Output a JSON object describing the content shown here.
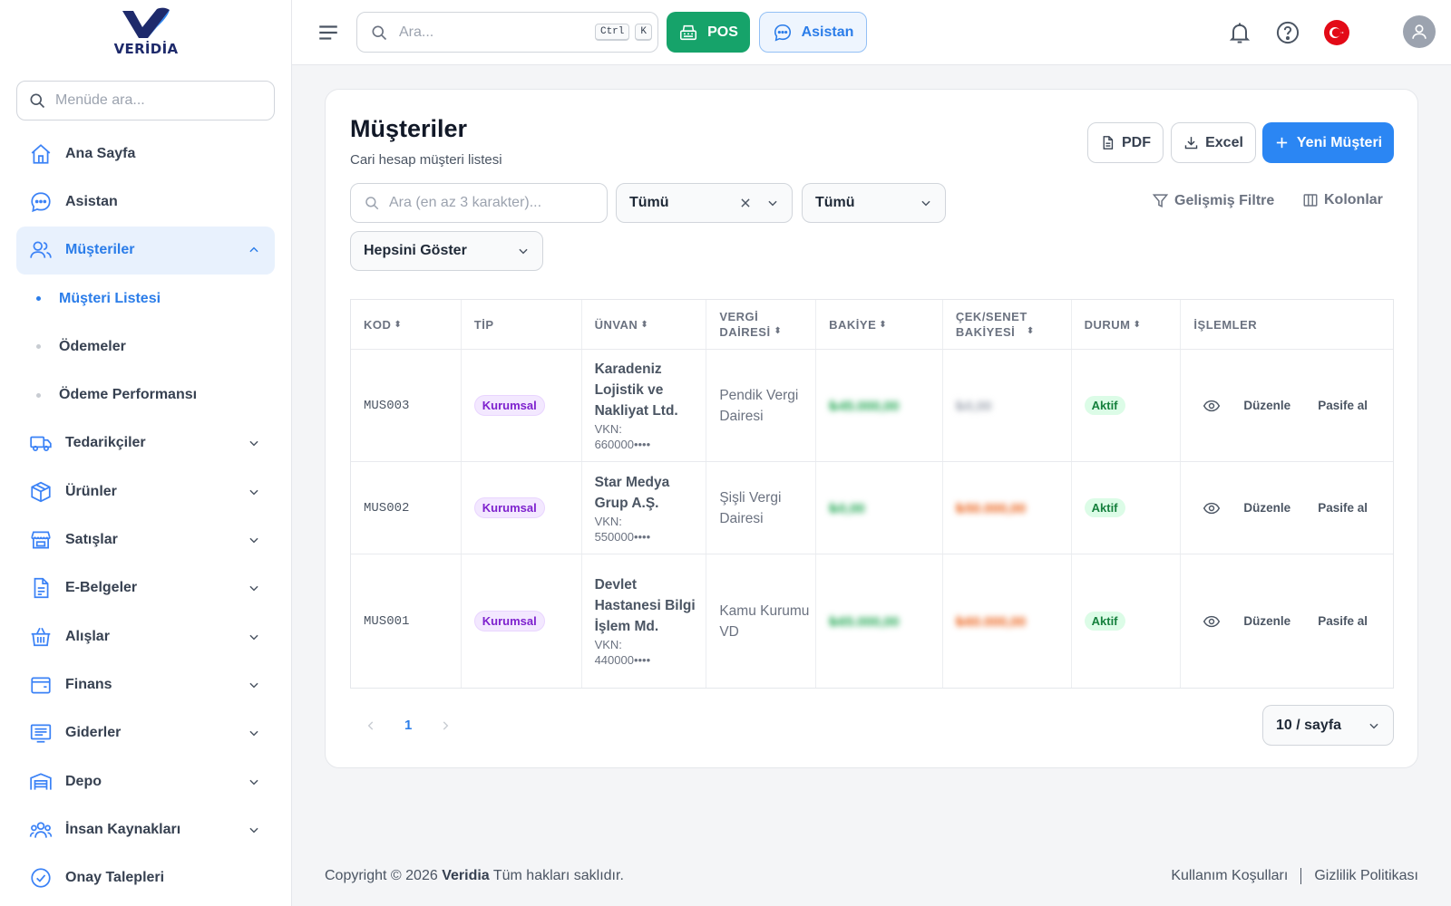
{
  "brand": {
    "name": "VERİDİA"
  },
  "sidebar": {
    "search_placeholder": "Menüde ara...",
    "items": [
      {
        "label": "Ana Sayfa",
        "icon": "home-icon"
      },
      {
        "label": "Asistan",
        "icon": "chat-icon"
      },
      {
        "label": "Müşteriler",
        "icon": "users-icon",
        "expanded": true,
        "children": [
          "Müşteri Listesi",
          "Ödemeler",
          "Ödeme Performansı"
        ]
      },
      {
        "label": "Tedarikçiler",
        "icon": "truck-icon"
      },
      {
        "label": "Ürünler",
        "icon": "box-icon"
      },
      {
        "label": "Satışlar",
        "icon": "store-icon"
      },
      {
        "label": "E-Belgeler",
        "icon": "document-icon"
      },
      {
        "label": "Alışlar",
        "icon": "basket-icon"
      },
      {
        "label": "Finans",
        "icon": "wallet-icon"
      },
      {
        "label": "Giderler",
        "icon": "receipt-icon"
      },
      {
        "label": "Depo",
        "icon": "warehouse-icon"
      },
      {
        "label": "İnsan Kaynakları",
        "icon": "people-icon"
      },
      {
        "label": "Onay Talepleri",
        "icon": "check-circle-icon"
      }
    ]
  },
  "topbar": {
    "search_placeholder": "Ara...",
    "shortcut_keys": [
      "Ctrl",
      "K"
    ],
    "pos_label": "POS",
    "assistant_label": "Asistan"
  },
  "page": {
    "title": "Müşteriler",
    "subtitle": "Cari hesap müşteri listesi",
    "pdf_label": "PDF",
    "excel_label": "Excel",
    "new_label": "Yeni Müşteri"
  },
  "filters": {
    "search_placeholder": "Ara (en az 3 karakter)...",
    "type_select": "Tümü",
    "status_select": "Tümü",
    "show_select": "Hepsini Göster",
    "advanced_label": "Gelişmiş Filtre",
    "columns_label": "Kolonlar"
  },
  "table": {
    "headers": [
      "KOD",
      "TİP",
      "ÜNVAN",
      "VERGİ DAİRESİ",
      "BAKİYE",
      "ÇEK/SENET BAKİYESİ",
      "DURUM",
      "İŞLEMLER"
    ],
    "rows": [
      {
        "code": "MUS003",
        "type": "Kurumsal",
        "name": "Karadeniz Lojistik ve Nakliyat Ltd.",
        "vkn_label": "VKN:",
        "vkn": "660000••••",
        "tax_office": "Pendik Vergi Dairesi",
        "balance": "₺45.000,00",
        "cheque": "₺0,00",
        "status": "Aktif"
      },
      {
        "code": "MUS002",
        "type": "Kurumsal",
        "name": "Star Medya Grup A.Ş.",
        "vkn_label": "VKN:",
        "vkn": "550000••••",
        "tax_office": "Şişli Vergi Dairesi",
        "balance": "₺0,00",
        "cheque": "₺50.000,00",
        "status": "Aktif"
      },
      {
        "code": "MUS001",
        "type": "Kurumsal",
        "name": "Devlet Hastanesi Bilgi İşlem Md.",
        "vkn_label": "VKN:",
        "vkn": "440000••••",
        "tax_office": "Kamu Kurumu VD",
        "balance": "₺65.000,00",
        "cheque": "₺60.000,00",
        "status": "Aktif"
      }
    ],
    "action_edit": "Düzenle",
    "action_deactivate": "Pasife al"
  },
  "pagination": {
    "current": "1",
    "per_page": "10 / sayfa"
  },
  "footer": {
    "copyright_prefix": "Copyright © 2026",
    "company": "Veridia",
    "copyright_suffix": "Tüm hakları saklıdır.",
    "terms": "Kullanım Koşulları",
    "privacy": "Gizlilik Politikası"
  },
  "colors": {
    "primary": "#2b86f3",
    "pos": "#16a36a",
    "active_bg": "#e8f1fd",
    "balance": "#16a34a",
    "cheque": "#ea580c"
  }
}
